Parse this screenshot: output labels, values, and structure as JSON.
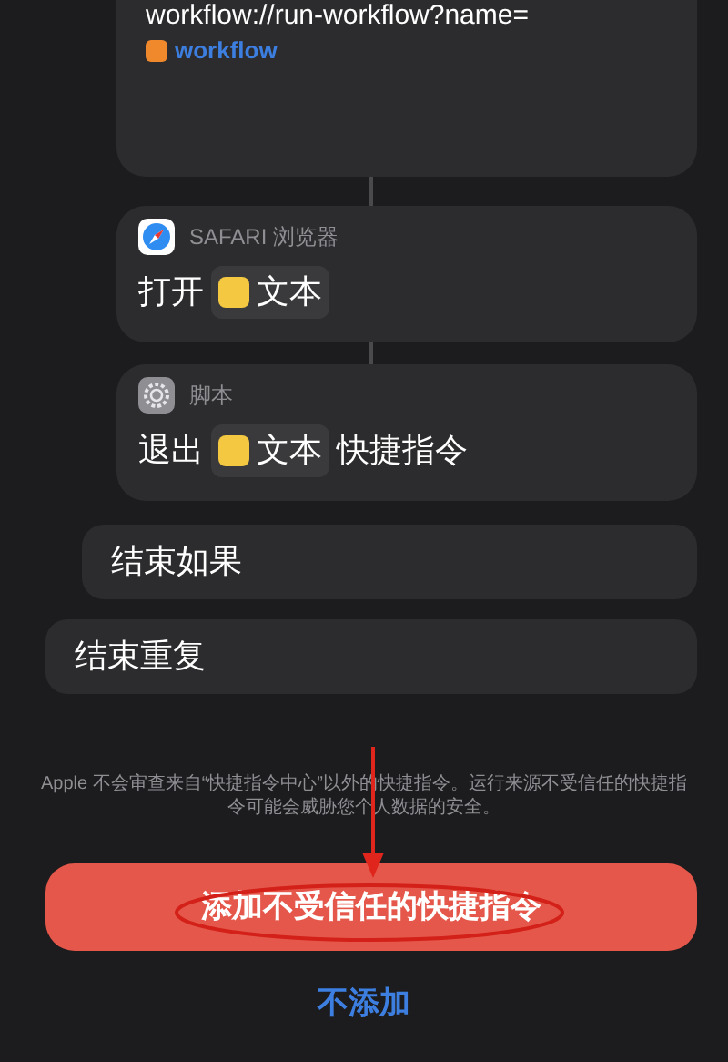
{
  "url_card": {
    "url": "workflow://run-workflow?name=",
    "token": "workflow"
  },
  "actions": [
    {
      "kind": "safari",
      "app": "SAFARI 浏览器",
      "verb": "打开",
      "token": "文本"
    },
    {
      "kind": "script",
      "app": "脚本",
      "verb": "退出",
      "token": "文本",
      "suffix": "快捷指令"
    }
  ],
  "blocks": [
    {
      "label": "结束如果",
      "indent": true
    },
    {
      "label": "结束重复",
      "indent": false
    }
  ],
  "warning": "Apple 不会审查来自“快捷指令中心”以外的快捷指令。运行来源不受信任的快捷指令可能会威胁您个人数据的安全。",
  "add_button": "添加不受信任的快捷指令",
  "cancel_button": "不添加"
}
